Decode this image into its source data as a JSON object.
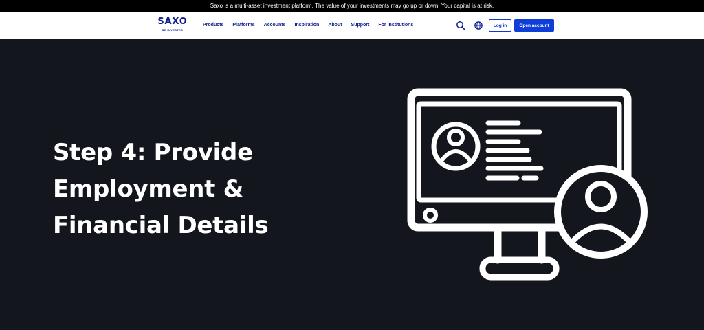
{
  "risk_banner": "Saxo is a multi-asset investment platform. The value of your investments may go up or down. Your capital is at risk.",
  "logo": {
    "word": "SAXO",
    "tagline": "BE INVESTED"
  },
  "nav": {
    "items": [
      {
        "label": "Products"
      },
      {
        "label": "Platforms"
      },
      {
        "label": "Accounts"
      },
      {
        "label": "Inspiration"
      },
      {
        "label": "About"
      },
      {
        "label": "Support"
      },
      {
        "label": "For institutions"
      }
    ],
    "login_label": "Log in",
    "open_account_label": "Open account"
  },
  "icons": {
    "search": "search-icon",
    "language": "globe-icon",
    "illustration": "monitor-profile-icon"
  },
  "hero": {
    "title_lines": [
      "Step 4: Provide",
      "Employment &",
      "Financial Details"
    ]
  },
  "colors": {
    "brand": "#0e1d8c",
    "cta": "#0f3fd8",
    "hero_bg": "#13161d",
    "top_bar": "#000000"
  }
}
